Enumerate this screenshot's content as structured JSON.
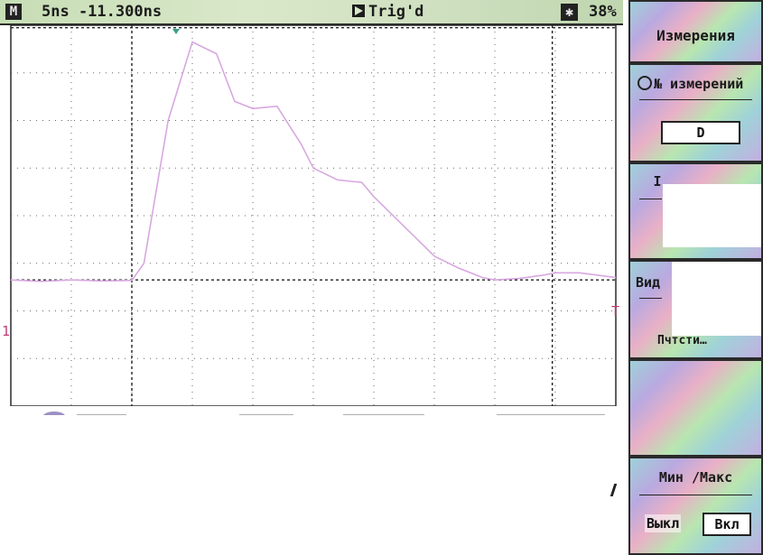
{
  "status_bar": {
    "mode_icon": "M",
    "timebase": "5ns -11.300ns",
    "trigger_status": "Trig'd",
    "battery": "38%"
  },
  "plot": {
    "channel_marker": "1",
    "trigger_marker": "T",
    "grid": true,
    "grid_divisions": {
      "x": 10,
      "y": 8
    },
    "trace": {
      "color": "#d8a8e0",
      "description_points_x_div": [
        0,
        0.5,
        1,
        1.5,
        2,
        2.2,
        2.6,
        3,
        3.4,
        3.7,
        4,
        4.4,
        4.8,
        5,
        5.4,
        5.8,
        6,
        6.4,
        6.8,
        7,
        7.4,
        7.8,
        8,
        8.4,
        8.8,
        9,
        9.4,
        10
      ],
      "description_points_y_div": [
        5.35,
        5.38,
        5.35,
        5.37,
        5.36,
        5.0,
        2.0,
        0.35,
        0.6,
        1.6,
        1.75,
        1.7,
        2.5,
        3.0,
        3.25,
        3.3,
        3.6,
        4.1,
        4.6,
        4.85,
        5.1,
        5.3,
        5.35,
        5.32,
        5.25,
        5.2,
        5.2,
        5.3
      ]
    },
    "cursor_x_div": [
      2.0,
      8.95
    ],
    "cursor_y_div": [
      0.05,
      5.35
    ],
    "trigger_point_x_div": 2.0
  },
  "sidebar": {
    "menu_title": "Измерения",
    "measurement_number_label": "№ измерений",
    "measurement_value": "D",
    "panel3_label": "I",
    "panel4_label": "Вид",
    "panel4_value": "Пчтсти…",
    "minmax_title": "Мин /Макс",
    "minmax_off": "Выкл",
    "minmax_on": "Вкл"
  },
  "colors": {
    "status_bar_bg": "#d2e4c4",
    "grid": "#444444",
    "trace": "#d8a8e0"
  }
}
